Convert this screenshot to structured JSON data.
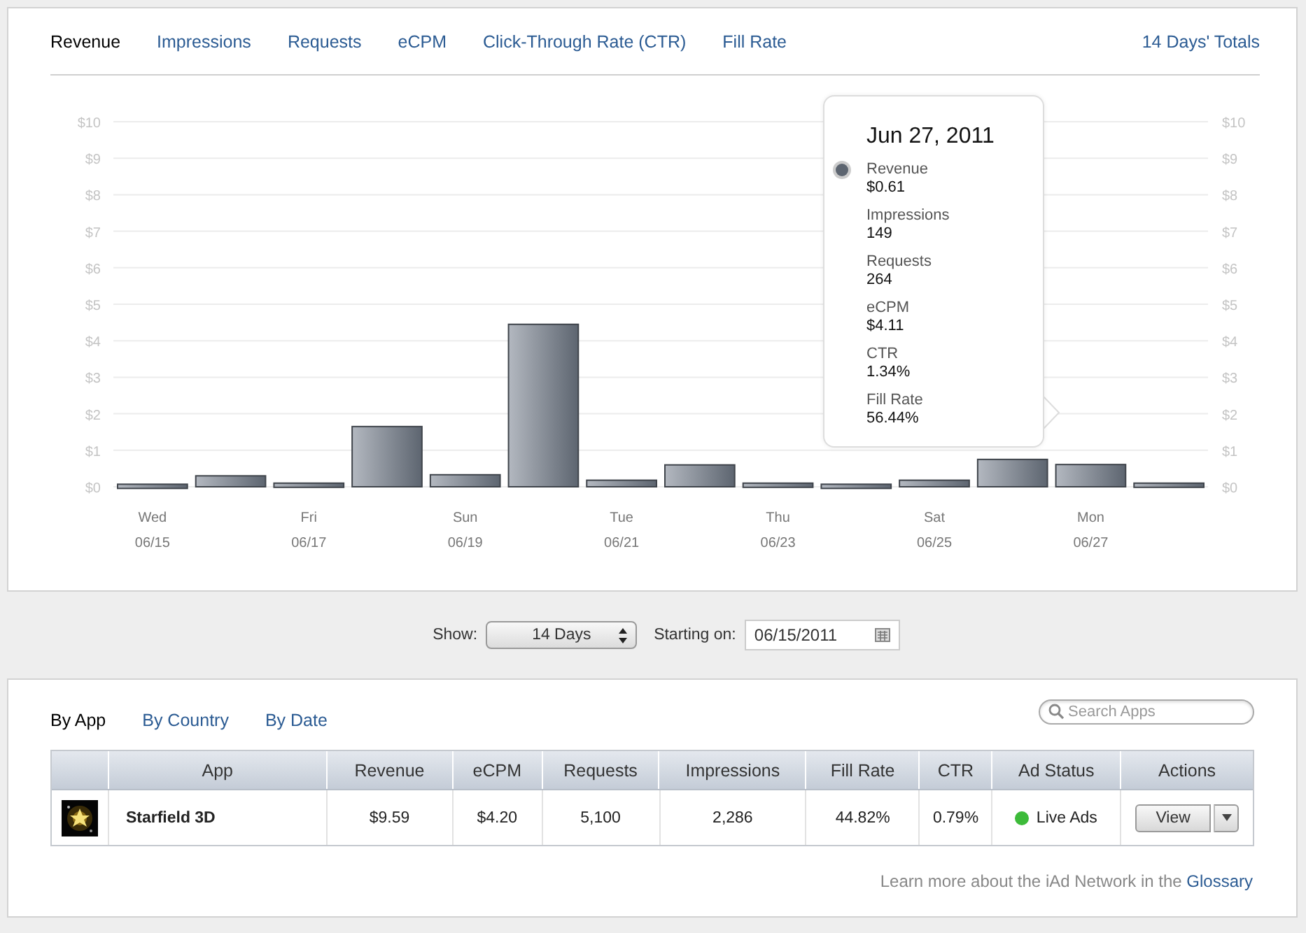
{
  "metric_tabs": [
    {
      "label": "Revenue",
      "selected": true
    },
    {
      "label": "Impressions",
      "selected": false
    },
    {
      "label": "Requests",
      "selected": false
    },
    {
      "label": "eCPM",
      "selected": false
    },
    {
      "label": "Click-Through Rate (CTR)",
      "selected": false
    },
    {
      "label": "Fill Rate",
      "selected": false
    }
  ],
  "totals_link": "14 Days' Totals",
  "chart": {
    "chart_data": {
      "type": "bar",
      "categories": [
        "Wed 06/15",
        null,
        "Fri 06/17",
        null,
        "Sun 06/19",
        null,
        "Tue 06/21",
        null,
        "Thu 06/23",
        null,
        "Sat 06/25",
        null,
        "Mon 06/27",
        null
      ],
      "values": [
        0.07,
        0.3,
        0.1,
        1.65,
        0.33,
        4.45,
        0.18,
        0.6,
        0.1,
        0.07,
        0.18,
        0.75,
        0.61,
        0.1
      ],
      "ylim": [
        0,
        10
      ],
      "grid": true,
      "yticks": [
        {
          "value": 0,
          "label": "$0"
        },
        {
          "value": 1,
          "label": "$1"
        },
        {
          "value": 2,
          "label": "$2"
        },
        {
          "value": 3,
          "label": "$3"
        },
        {
          "value": 4,
          "label": "$4"
        },
        {
          "value": 5,
          "label": "$5"
        },
        {
          "value": 6,
          "label": "$6"
        },
        {
          "value": 7,
          "label": "$7"
        },
        {
          "value": 8,
          "label": "$8"
        },
        {
          "value": 9,
          "label": "$9"
        },
        {
          "value": 10,
          "label": "$10"
        }
      ]
    },
    "tooltip": {
      "date": "Jun 27, 2011",
      "items": [
        {
          "label": "Revenue",
          "value": "$0.61",
          "selected": true
        },
        {
          "label": "Impressions",
          "value": "149",
          "selected": false
        },
        {
          "label": "Requests",
          "value": "264",
          "selected": false
        },
        {
          "label": "eCPM",
          "value": "$4.11",
          "selected": false
        },
        {
          "label": "CTR",
          "value": "1.34%",
          "selected": false
        },
        {
          "label": "Fill Rate",
          "value": "56.44%",
          "selected": false
        }
      ]
    }
  },
  "range": {
    "show_label": "Show:",
    "period": "14 Days",
    "start_label": "Starting on:",
    "start_date": "06/15/2011"
  },
  "breakdown_tabs": [
    {
      "label": "By App",
      "selected": true
    },
    {
      "label": "By Country",
      "selected": false
    },
    {
      "label": "By Date",
      "selected": false
    }
  ],
  "search": {
    "placeholder": "Search Apps"
  },
  "table": {
    "columns": [
      "App",
      "Revenue",
      "eCPM",
      "Requests",
      "Impressions",
      "Fill Rate",
      "CTR",
      "Ad Status",
      "Actions"
    ],
    "rows": [
      {
        "app": "Starfield 3D",
        "revenue": "$9.59",
        "ecpm": "$4.20",
        "requests": "5,100",
        "impressions": "2,286",
        "fill_rate": "44.82%",
        "ctr": "0.79%",
        "status": {
          "label": "Live Ads",
          "color": "#3dbb3a"
        },
        "action": "View"
      }
    ]
  },
  "footer": {
    "text": "Learn more about the iAd Network in the",
    "link": "Glossary"
  }
}
